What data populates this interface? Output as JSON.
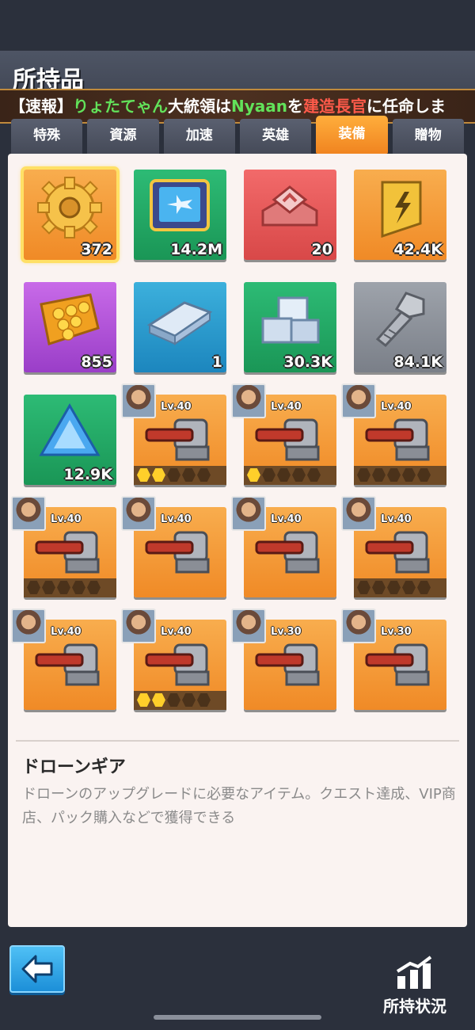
{
  "page_title": "所持品",
  "ticker": {
    "bracket": "【速報】",
    "player": "りょたてゃん",
    "mid1": "大統領は",
    "target": "Nyaan",
    "mid2": "を",
    "role": "建造長官",
    "tail": "に任命しま"
  },
  "tabs": [
    {
      "label": "特殊"
    },
    {
      "label": "資源"
    },
    {
      "label": "加速"
    },
    {
      "label": "英雄"
    },
    {
      "label": "装備",
      "active": true
    },
    {
      "label": "贈物"
    }
  ],
  "items": [
    {
      "icon": "drone-gear-icon",
      "count": "372",
      "bg": "orange",
      "selected": true
    },
    {
      "icon": "drone-chip-icon",
      "count": "14.2M",
      "bg": "green"
    },
    {
      "icon": "red-box-icon",
      "count": "20",
      "bg": "red"
    },
    {
      "icon": "battery-icon",
      "count": "42.4K",
      "bg": "orange"
    },
    {
      "icon": "honeycomb-icon",
      "count": "855",
      "bg": "purple"
    },
    {
      "icon": "steel-bar-icon",
      "count": "1",
      "bg": "blue"
    },
    {
      "icon": "ingot-stack-icon",
      "count": "30.3K",
      "bg": "green"
    },
    {
      "icon": "bolt-icon",
      "count": "84.1K",
      "bg": "gray"
    },
    {
      "icon": "crystal-icon",
      "count": "12.9K",
      "bg": "green"
    }
  ],
  "gear": [
    {
      "level": "Lv.40",
      "stars": 2
    },
    {
      "level": "Lv.40",
      "stars": 1
    },
    {
      "level": "Lv.40",
      "stars": 0
    },
    {
      "level": "Lv.40",
      "stars": 0
    },
    {
      "level": "Lv.40",
      "stars": null
    },
    {
      "level": "Lv.40",
      "stars": null
    },
    {
      "level": "Lv.40",
      "stars": 0
    },
    {
      "level": "Lv.40",
      "stars": null
    },
    {
      "level": "Lv.40",
      "stars": 2
    },
    {
      "level": "Lv.30",
      "stars": null
    },
    {
      "level": "Lv.30",
      "stars": null
    }
  ],
  "description": {
    "title": "ドローンギア",
    "body": "ドローンのアップグレードに必要なアイテム。クエスト達成、VIP商店、パック購入などで獲得できる"
  },
  "footer": {
    "status_label": "所持状況"
  },
  "colors": {
    "accent": "#f08420",
    "panel": "#faf3f1",
    "background": "#2b303c"
  }
}
